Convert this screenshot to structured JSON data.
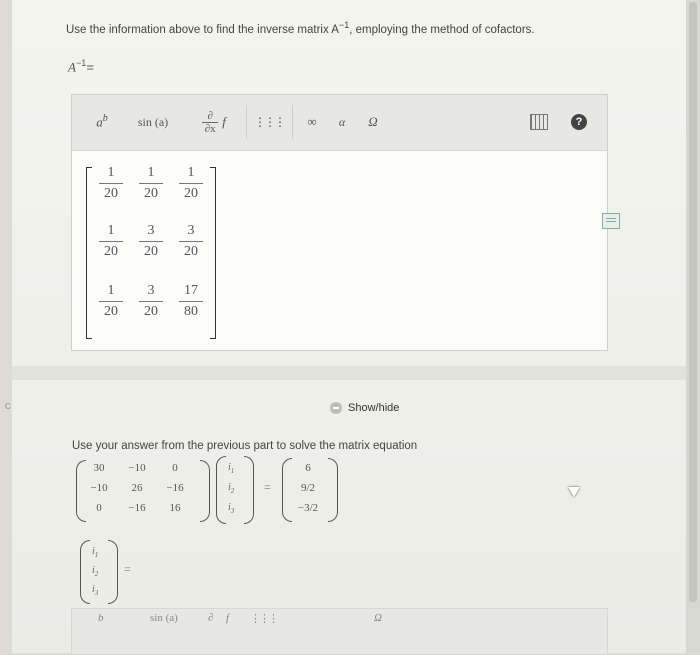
{
  "prompt": {
    "text_before": "Use the information above to find the inverse matrix A",
    "sup": "−1",
    "text_after": ", employing the method of cofactors."
  },
  "answer_label": {
    "name": "A",
    "sup": "−1",
    "eq": "="
  },
  "toolbar": {
    "items": [
      {
        "name": "power-button",
        "icon": "power-icon",
        "label": "a",
        "sup": "b"
      },
      {
        "name": "function-button",
        "icon": "function-icon",
        "label": "sin (a)"
      },
      {
        "name": "derivative-button",
        "icon": "derivative-icon",
        "num": "∂",
        "den": "∂x",
        "f": "f"
      },
      {
        "name": "matrix-button",
        "icon": "matrix-grid-icon",
        "label": "⋮⋮⋮"
      },
      {
        "name": "infinity-button",
        "icon": "infinity-icon",
        "label": "∞"
      },
      {
        "name": "alpha-button",
        "icon": "alpha-icon",
        "label": "α"
      },
      {
        "name": "omega-button",
        "icon": "omega-icon",
        "label": "Ω"
      },
      {
        "name": "keyboard-button",
        "icon": "keyboard-icon",
        "label": ""
      },
      {
        "name": "help-button",
        "icon": "help-icon",
        "label": "?"
      }
    ]
  },
  "matrix": {
    "rows": [
      [
        {
          "n": "1",
          "d": "20"
        },
        {
          "n": "1",
          "d": "20"
        },
        {
          "n": "1",
          "d": "20"
        }
      ],
      [
        {
          "n": "1",
          "d": "20"
        },
        {
          "n": "3",
          "d": "20"
        },
        {
          "n": "3",
          "d": "20"
        }
      ],
      [
        {
          "n": "1",
          "d": "20"
        },
        {
          "n": "3",
          "d": "20"
        },
        {
          "n": "17",
          "d": "80"
        }
      ]
    ]
  },
  "side_letter": "C",
  "showhide_label": "Show/hide",
  "prompt2": "Use your answer from the previous part to solve the matrix equation",
  "equation": {
    "coeff": [
      [
        "30",
        "−10",
        "0"
      ],
      [
        "−10",
        "26",
        "−16"
      ],
      [
        "0",
        "−16",
        "16"
      ]
    ],
    "vars": [
      {
        "b": "i",
        "s": "1"
      },
      {
        "b": "i",
        "s": "2"
      },
      {
        "b": "i",
        "s": "3"
      }
    ],
    "eq": "=",
    "rhs": [
      "6",
      "9/2",
      "−3/2"
    ]
  },
  "answer_vector": {
    "vars": [
      {
        "b": "i",
        "s": "1"
      },
      {
        "b": "i",
        "s": "2"
      },
      {
        "b": "i",
        "s": "3"
      }
    ],
    "eq": "="
  },
  "bottom_toolbar": {
    "items": [
      "b",
      "sin (a)",
      "∂",
      "f",
      "⋮⋮⋮",
      "Ω"
    ]
  }
}
